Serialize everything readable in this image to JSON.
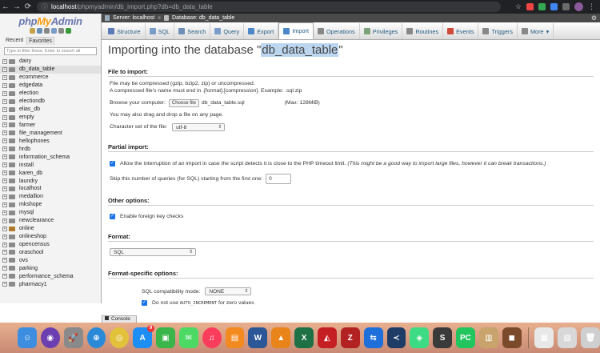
{
  "browser": {
    "url_host": "localhost",
    "url_path": "/phpmyadmin/db_import.php?db=db_data_table"
  },
  "sidebar": {
    "logo_php": "php",
    "logo_my": "My",
    "logo_admin": "Admin",
    "tab_recent": "Recent",
    "tab_favorites": "Favorites",
    "filter_placeholder": "Type to filter these, Enter to search all",
    "databases": [
      "dairy",
      "db_data_table",
      "ecommerce",
      "edgedata",
      "election",
      "electiondb",
      "elias_db",
      "emply",
      "farmer",
      "file_management",
      "hellophones",
      "hrdb",
      "information_schema",
      "install",
      "karen_db",
      "laundry",
      "localhost",
      "medallion",
      "mkshope",
      "mysql",
      "newclearance",
      "online",
      "onlineshop",
      "opencensus",
      "oraschool",
      "ovs",
      "parking",
      "performance_schema",
      "pharmacy1"
    ],
    "active_db": "db_data_table"
  },
  "topbar": {
    "server": "Server: localhost",
    "sep": "»",
    "database": "Database: db_data_table"
  },
  "tabs": [
    {
      "label": "Structure",
      "icon": "structure-icon",
      "color": "#5a7bb5"
    },
    {
      "label": "SQL",
      "icon": "sql-icon",
      "color": "#7a9cc8"
    },
    {
      "label": "Search",
      "icon": "search-icon",
      "color": "#6f8fb8"
    },
    {
      "label": "Query",
      "icon": "query-icon",
      "color": "#7a9cc8"
    },
    {
      "label": "Export",
      "icon": "export-icon",
      "color": "#4c87c9"
    },
    {
      "label": "Import",
      "icon": "import-icon",
      "color": "#4c87c9"
    },
    {
      "label": "Operations",
      "icon": "wrench-icon",
      "color": "#888"
    },
    {
      "label": "Privileges",
      "icon": "privileges-icon",
      "color": "#7aa37a"
    },
    {
      "label": "Routines",
      "icon": "routines-icon",
      "color": "#888"
    },
    {
      "label": "Events",
      "icon": "events-icon",
      "color": "#d04a3a"
    },
    {
      "label": "Triggers",
      "icon": "triggers-icon",
      "color": "#888"
    },
    {
      "label": "More",
      "icon": "more-icon",
      "color": "#888"
    }
  ],
  "active_tab": "Import",
  "main": {
    "title_prefix": "Importing into the database \"",
    "title_db": "db_data_table",
    "title_suffix": "\"",
    "file_import": {
      "heading": "File to import:",
      "line1": "File may be compressed (gzip, bzip2, zip) or uncompressed.",
      "line2": "A compressed file's name must end in .[format].[compression]. Example: .sql.zip",
      "browse_label": "Browse your computer:",
      "choose_button": "Choose file",
      "chosen_file": "db_data_table.sql",
      "max_size": "(Max: 128MiB)",
      "drag_text": "You may also drag and drop a file on any page.",
      "charset_label": "Character set of the file:",
      "charset_value": "utf-8"
    },
    "partial_import": {
      "heading": "Partial import:",
      "allow_interrupt": "Allow the interruption of an import in case the script detects it is close to the PHP timeout limit.",
      "allow_interrupt_note": "(This might be a good way to import large files, however it can break transactions.)",
      "skip_label": "Skip this number of queries (for SQL) starting from the first one:",
      "skip_value": "0"
    },
    "other_options": {
      "heading": "Other options:",
      "foreign_keys": "Enable foreign key checks"
    },
    "format": {
      "heading": "Format:",
      "value": "SQL"
    },
    "format_specific": {
      "heading": "Format-specific options:",
      "compat_label": "SQL compatibility mode:",
      "compat_value": "NONE",
      "auto_inc_prefix": "Do not use",
      "auto_inc_mono": "AUTO_INCREMENT",
      "auto_inc_suffix": "for zero values"
    }
  },
  "console": {
    "label": "Console"
  },
  "dock": [
    {
      "name": "finder",
      "color": "#3d8ee0",
      "glyph": "☺"
    },
    {
      "name": "siri",
      "color": "#6b3fb0",
      "glyph": "◉"
    },
    {
      "name": "launchpad",
      "color": "#8a8a8a",
      "glyph": "🚀"
    },
    {
      "name": "safari",
      "color": "#2b8ad8",
      "glyph": "⊕"
    },
    {
      "name": "chrome",
      "color": "#e2c13b",
      "glyph": "◎"
    },
    {
      "name": "app-store",
      "color": "#1d8ef3",
      "glyph": "A",
      "badge": "9"
    },
    {
      "name": "facetime",
      "color": "#3ab54a",
      "glyph": "▣"
    },
    {
      "name": "messages",
      "color": "#4cd964",
      "glyph": "✉"
    },
    {
      "name": "music",
      "color": "#fa3d5c",
      "glyph": "♫"
    },
    {
      "name": "books",
      "color": "#f28a1f",
      "glyph": "▤"
    },
    {
      "name": "word",
      "color": "#2b5797",
      "glyph": "W"
    },
    {
      "name": "vlc",
      "color": "#e8841a",
      "glyph": "▲"
    },
    {
      "name": "excel",
      "color": "#1e7145",
      "glyph": "X"
    },
    {
      "name": "acrobat",
      "color": "#c51f24",
      "glyph": "◭"
    },
    {
      "name": "filezilla",
      "color": "#b22222",
      "glyph": "Z"
    },
    {
      "name": "teamviewer",
      "color": "#1e6fd9",
      "glyph": "⇆"
    },
    {
      "name": "vscode",
      "color": "#1e3c66",
      "glyph": "≺"
    },
    {
      "name": "android-studio",
      "color": "#3ddc84",
      "glyph": "◈"
    },
    {
      "name": "sublime",
      "color": "#3a3a3a",
      "glyph": "S"
    },
    {
      "name": "pycharm",
      "color": "#22c55e",
      "glyph": "PC"
    },
    {
      "name": "preview",
      "color": "#c9a36c",
      "glyph": "▥"
    },
    {
      "name": "app-misc",
      "color": "#7a4a2a",
      "glyph": "◼"
    },
    {
      "name": "documents",
      "color": "#e8e8e8",
      "glyph": "▦"
    },
    {
      "name": "downloads",
      "color": "#d8d8d8",
      "glyph": "▧"
    },
    {
      "name": "trash",
      "color": "#cfcfcf",
      "glyph": "🗑"
    }
  ]
}
